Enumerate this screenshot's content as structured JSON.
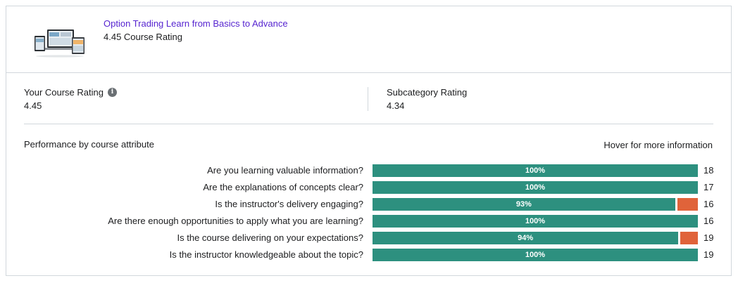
{
  "course": {
    "title": "Option Trading Learn from Basics to Advance",
    "rating_text": "4.45 Course Rating",
    "thumbnail_icon": "course-thumbnail-image"
  },
  "your_rating": {
    "label": "Your Course Rating",
    "value": "4.45",
    "info_icon": "info-icon"
  },
  "subcategory_rating": {
    "label": "Subcategory Rating",
    "value": "4.34"
  },
  "performance": {
    "title": "Performance by course attribute",
    "hint": "Hover for more information",
    "colors": {
      "positive": "#2d907f",
      "negative": "#e0633a"
    },
    "attributes": [
      {
        "question": "Are you learning valuable information?",
        "percent_label": "100%",
        "percent": 100,
        "count": "18"
      },
      {
        "question": "Are the explanations of concepts clear?",
        "percent_label": "100%",
        "percent": 100,
        "count": "17"
      },
      {
        "question": "Is the instructor's delivery engaging?",
        "percent_label": "93%",
        "percent": 93,
        "count": "16"
      },
      {
        "question": "Are there enough opportunities to apply what you are learning?",
        "percent_label": "100%",
        "percent": 100,
        "count": "16"
      },
      {
        "question": "Is the course delivering on your expectations?",
        "percent_label": "94%",
        "percent": 94,
        "count": "19"
      },
      {
        "question": "Is the instructor knowledgeable about the topic?",
        "percent_label": "100%",
        "percent": 100,
        "count": "19"
      }
    ]
  }
}
